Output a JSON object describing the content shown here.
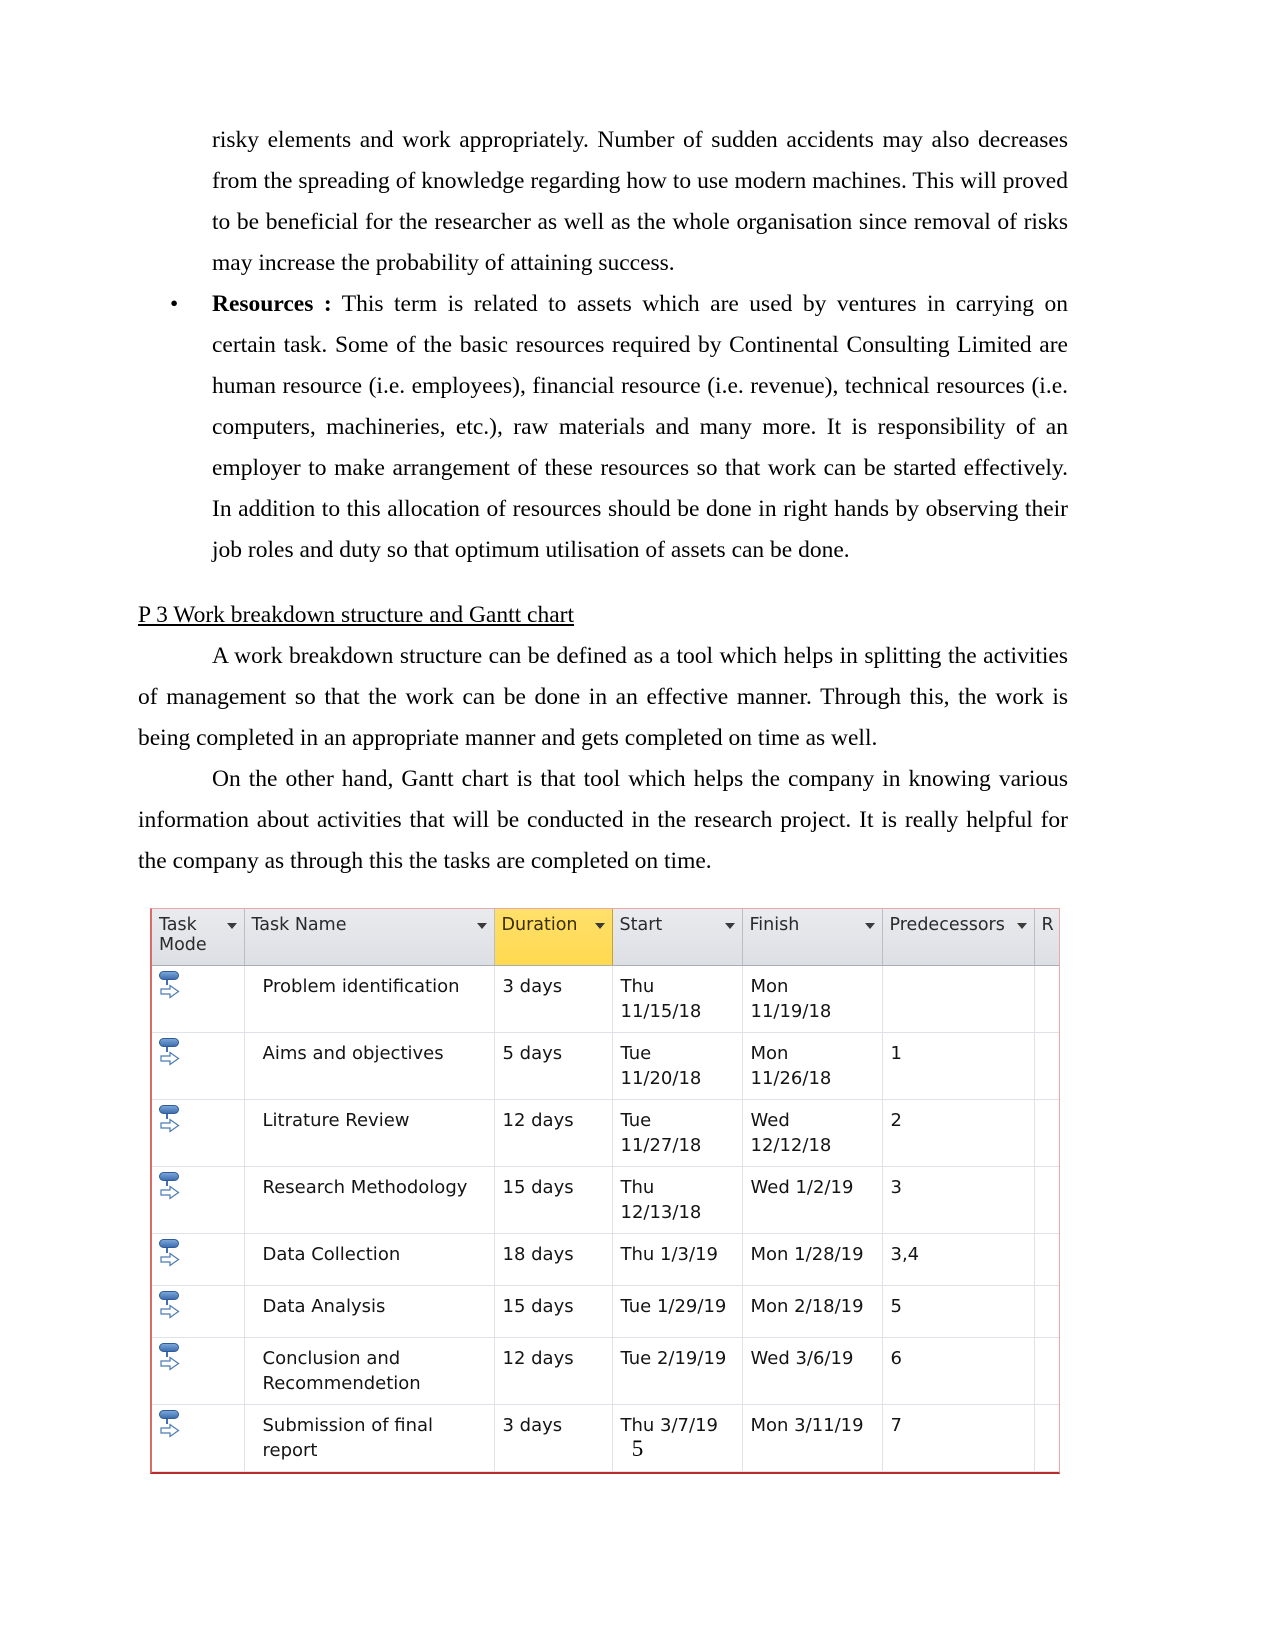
{
  "document": {
    "page_number": "5",
    "paragraphs": {
      "p1": "risky elements and work appropriately. Number of sudden accidents may also decreases from the spreading of knowledge regarding how to use modern machines. This will proved to be beneficial for the researcher as well as the whole organisation since removal of risks may increase the probability of attaining success.",
      "bullet_marker": "•",
      "bullet_term": "Resources :",
      "bullet_text": " This term is related to assets which are used by ventures in carrying on certain task. Some of the basic resources required by Continental Consulting Limited are human resource (i.e. employees), financial resource (i.e. revenue), technical resources (i.e. computers, machineries, etc.), raw materials and many more. It is responsibility of an employer to make arrangement of these resources so that work can be started effectively. In addition to this allocation of resources should be done in right hands by observing their job roles and duty so that optimum utilisation of assets can be done.",
      "heading": "P 3 Work breakdown structure and Gantt chart",
      "p2": "A work breakdown structure can be defined as a tool which helps in splitting the activities of management so that the work can be done in an effective manner. Through this, the work is being completed in an appropriate manner and gets completed on time as well.",
      "p3": "On the other hand, Gantt chart is that tool which helps the company in knowing various information about activities that will be conducted in the research project. It is really helpful for the company as through this the tasks are completed on time."
    }
  },
  "project_table": {
    "accent_header_color": "#ffd94f",
    "border_color": "#b92c2c",
    "columns": [
      {
        "label": "Task Mode",
        "filter_icon": "chevron-down-icon",
        "highlighted": false
      },
      {
        "label": "Task Name",
        "filter_icon": "chevron-down-icon",
        "highlighted": false
      },
      {
        "label": "Duration",
        "filter_icon": "chevron-down-icon",
        "highlighted": true
      },
      {
        "label": "Start",
        "filter_icon": "chevron-down-icon",
        "highlighted": false
      },
      {
        "label": "Finish",
        "filter_icon": "chevron-down-icon",
        "highlighted": false
      },
      {
        "label": "Predecessors",
        "filter_icon": "chevron-down-icon",
        "highlighted": false
      },
      {
        "label": "R",
        "filter_icon": "",
        "highlighted": false
      }
    ],
    "task_mode_icon": "auto-scheduled-icon",
    "rows": [
      {
        "mode": "auto-scheduled-icon",
        "name": "Problem identification",
        "duration": "3 days",
        "start": "Thu 11/15/18",
        "finish": "Mon 11/19/18",
        "predecessors": ""
      },
      {
        "mode": "auto-scheduled-icon",
        "name": "Aims and objectives",
        "duration": "5 days",
        "start": "Tue 11/20/18",
        "finish": "Mon 11/26/18",
        "predecessors": "1"
      },
      {
        "mode": "auto-scheduled-icon",
        "name": "Litrature Review",
        "duration": "12 days",
        "start": "Tue 11/27/18",
        "finish": "Wed 12/12/18",
        "predecessors": "2"
      },
      {
        "mode": "auto-scheduled-icon",
        "name": "Research Methodology",
        "duration": "15 days",
        "start": "Thu 12/13/18",
        "finish": "Wed 1/2/19",
        "predecessors": "3"
      },
      {
        "mode": "auto-scheduled-icon",
        "name": "Data Collection",
        "duration": "18 days",
        "start": "Thu 1/3/19",
        "finish": "Mon 1/28/19",
        "predecessors": "3,4"
      },
      {
        "mode": "auto-scheduled-icon",
        "name": "Data Analysis",
        "duration": "15 days",
        "start": "Tue 1/29/19",
        "finish": "Mon 2/18/19",
        "predecessors": "5"
      },
      {
        "mode": "auto-scheduled-icon",
        "name": "Conclusion and Recommendetion",
        "duration": "12 days",
        "start": "Tue 2/19/19",
        "finish": "Wed 3/6/19",
        "predecessors": "6"
      },
      {
        "mode": "auto-scheduled-icon",
        "name": "Submission of final report",
        "duration": "3 days",
        "start": "Thu 3/7/19",
        "finish": "Mon 3/11/19",
        "predecessors": "7"
      }
    ]
  }
}
